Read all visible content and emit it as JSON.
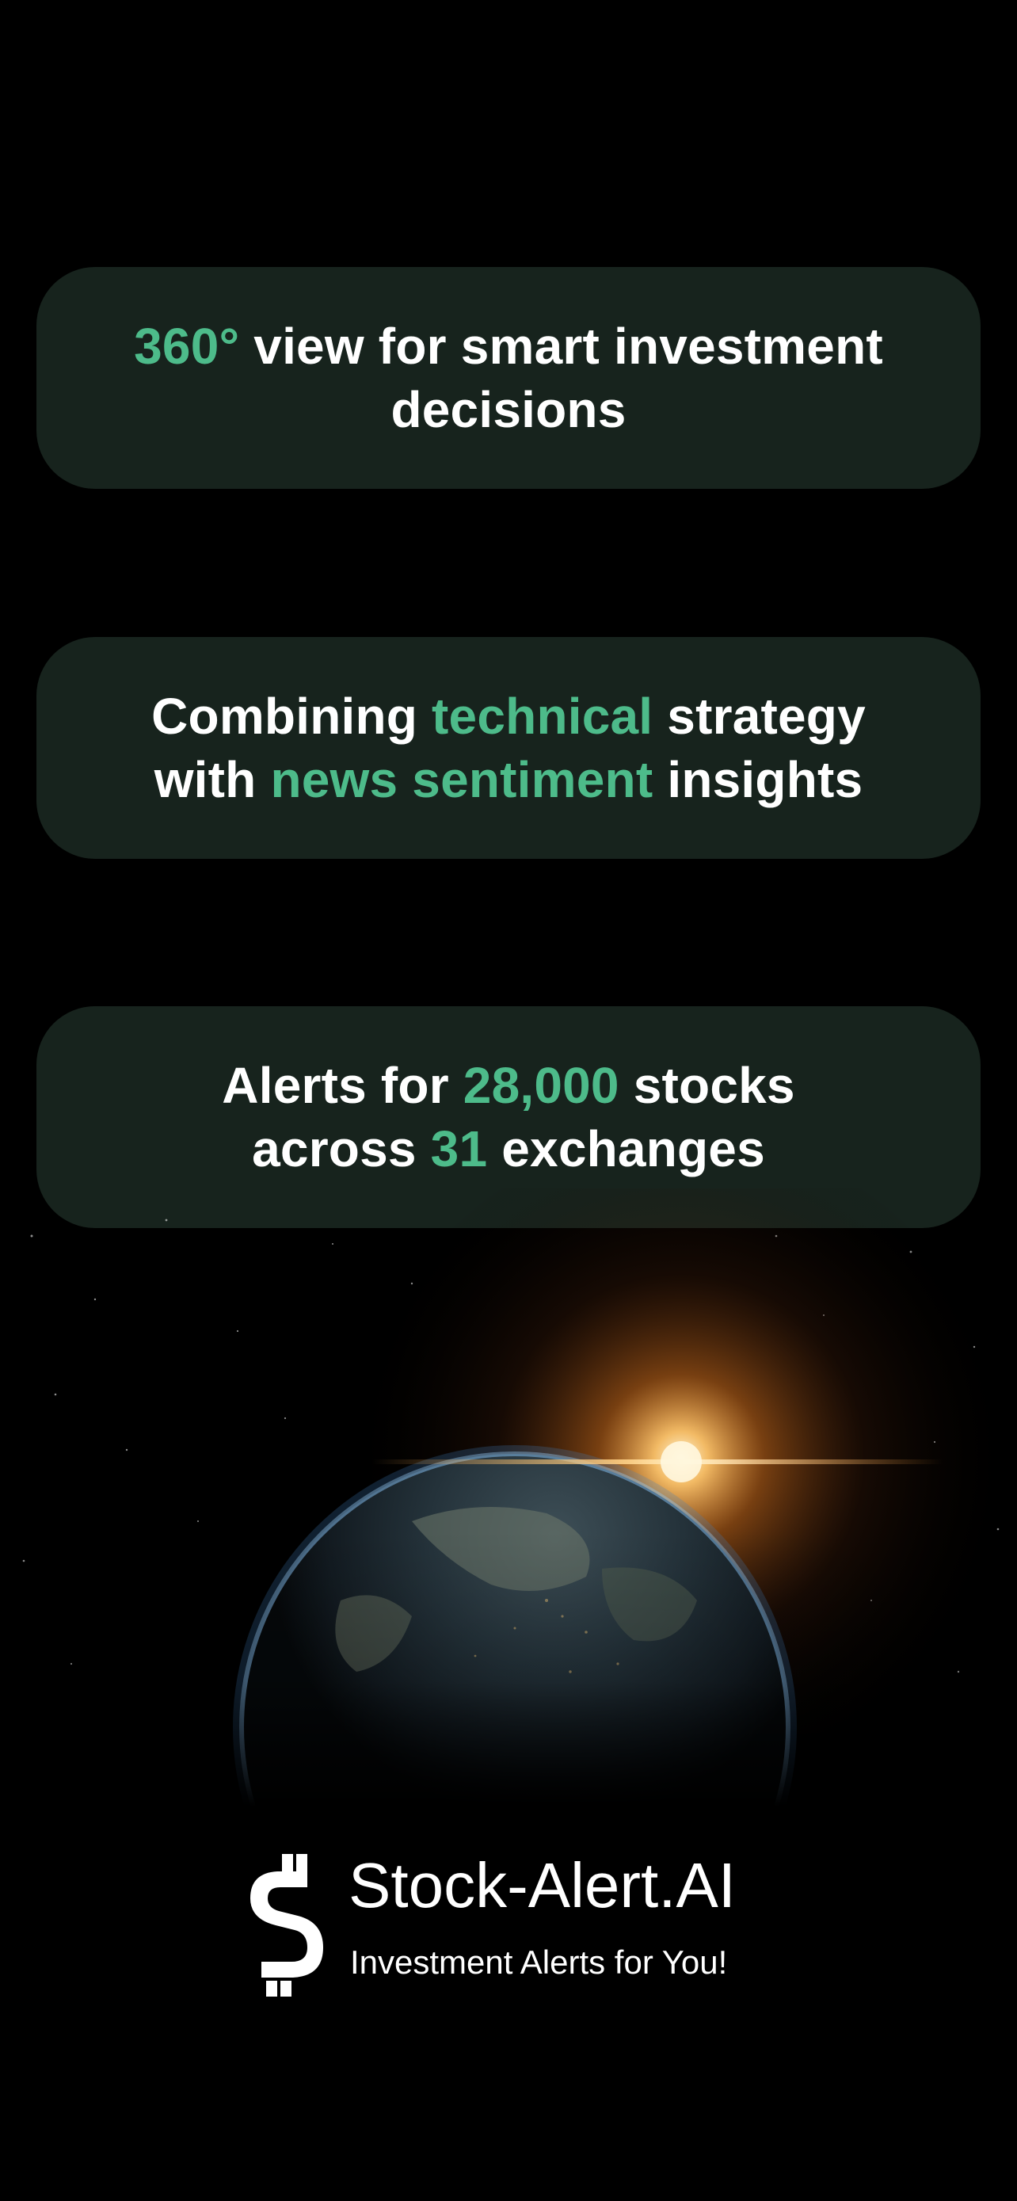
{
  "cards": [
    {
      "line1_accent": "360°",
      "line1_rest": " view for smart investment",
      "line2": "decisions"
    },
    {
      "line1_pre": "Combining ",
      "line1_accent": "technical",
      "line1_post": " strategy",
      "line2_pre": "with ",
      "line2_accent": "news sentiment",
      "line2_post": " insights"
    },
    {
      "line1_pre": "Alerts for ",
      "line1_accent": "28,000",
      "line1_post": " stocks",
      "line2_pre": "across ",
      "line2_accent": "31",
      "line2_post": " exchanges"
    }
  ],
  "brand": {
    "name": "Stock-Alert.AI",
    "tagline": "Investment Alerts for You!",
    "logo_icon": "dollar-sign-logo-icon"
  },
  "hero_image": "earth-sunrise-from-space",
  "colors": {
    "background": "#000000",
    "card_background": "#17231d",
    "accent": "#4dbb8a",
    "text": "#ffffff"
  }
}
